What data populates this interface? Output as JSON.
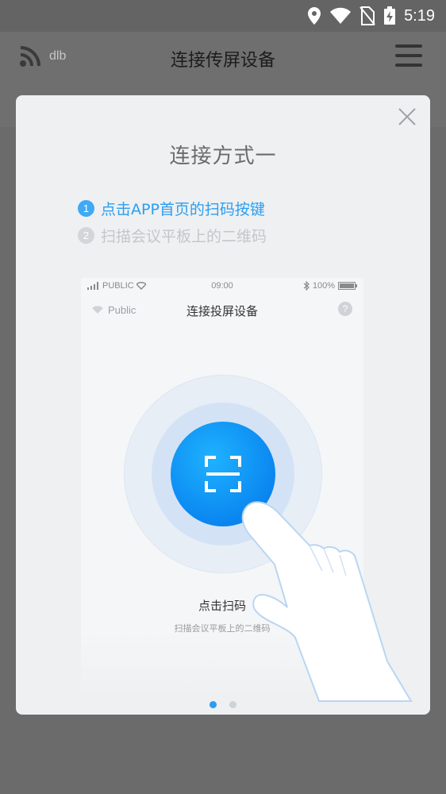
{
  "status_bar": {
    "time": "5:19"
  },
  "app_bar": {
    "left_label": "dlb",
    "title": "连接传屏设备"
  },
  "dialog": {
    "title": "连接方式一",
    "steps": [
      {
        "num": "1",
        "text": "点击APP首页的扫码按键",
        "active": true
      },
      {
        "num": "2",
        "text": "扫描会议平板上的二维码",
        "active": false
      }
    ],
    "phone": {
      "carrier": "PUBLIC",
      "time": "09:00",
      "battery": "100%",
      "wifi_name": "Public",
      "title": "连接投屏设备",
      "help": "?",
      "button_label": "点击扫码",
      "sub_label": "扫描会议平板上的二维码"
    },
    "pagination": {
      "total": 2,
      "current": 1
    }
  },
  "colors": {
    "accent": "#2b9ef0",
    "scan_button": "#0a86f0",
    "dialog_bg": "#eef0f2"
  }
}
